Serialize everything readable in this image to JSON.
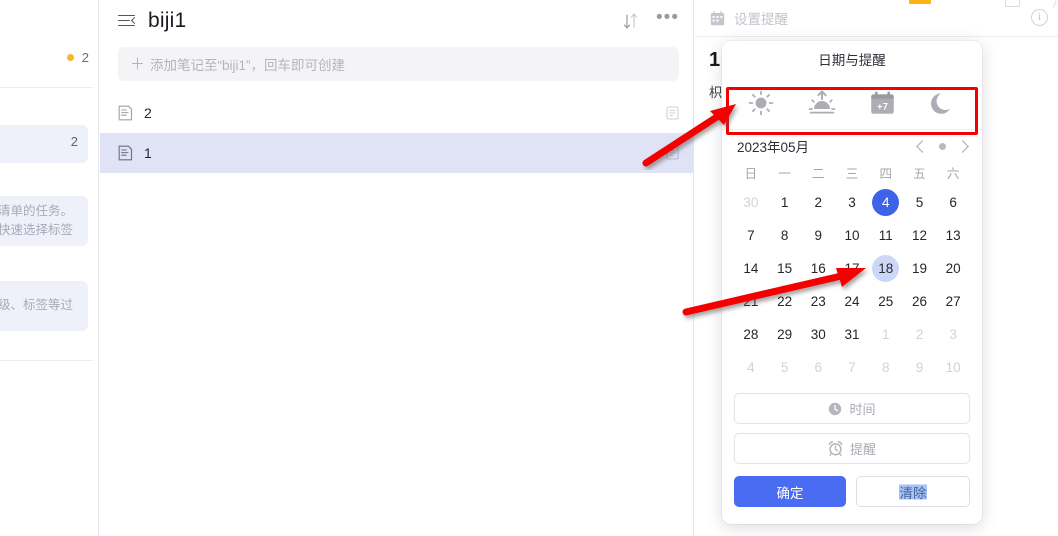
{
  "sidebar_fragment": {
    "count_top": "2",
    "count_card": "2",
    "text_frag_1_line1": "清单的任务。",
    "text_frag_1_line2": "快速选择标签",
    "text_frag_2": "级、标签等过"
  },
  "note_list": {
    "title": "biji1",
    "menu_icon": "hamburger-collapse-icon",
    "sort_icon": "sort-icon",
    "more_icon": "more-options-icon",
    "add_placeholder": "添加笔记至“biji1”，回车即可创建",
    "add_plus": "＋",
    "items": [
      {
        "label": "2",
        "selected": false
      },
      {
        "label": "1",
        "selected": true
      }
    ]
  },
  "detail": {
    "toolbar_label": "设置提醒",
    "toolbar_icon": "calendar-icon",
    "info_icon": "info-icon",
    "title": "1",
    "subtitle": "枳"
  },
  "date_picker": {
    "title": "日期与提醒",
    "quick_actions": [
      {
        "name": "today-sun-icon",
        "label": "今天"
      },
      {
        "name": "tomorrow-sunrise-icon",
        "label": "明天"
      },
      {
        "name": "next-week-plus7-icon",
        "label": "+7"
      },
      {
        "name": "tonight-moon-icon",
        "label": "今晚"
      }
    ],
    "month_label": "2023年05月",
    "prev_icon": "chevron-left-icon",
    "today-dot_icon": "today-dot-icon",
    "next_icon": "chevron-right-icon",
    "weekdays": [
      "日",
      "一",
      "二",
      "三",
      "四",
      "五",
      "六"
    ],
    "weeks": [
      [
        {
          "d": "30",
          "state": "muted"
        },
        {
          "d": "1",
          "state": ""
        },
        {
          "d": "2",
          "state": ""
        },
        {
          "d": "3",
          "state": ""
        },
        {
          "d": "4",
          "state": "selected"
        },
        {
          "d": "5",
          "state": ""
        },
        {
          "d": "6",
          "state": ""
        }
      ],
      [
        {
          "d": "7",
          "state": ""
        },
        {
          "d": "8",
          "state": ""
        },
        {
          "d": "9",
          "state": ""
        },
        {
          "d": "10",
          "state": ""
        },
        {
          "d": "11",
          "state": ""
        },
        {
          "d": "12",
          "state": ""
        },
        {
          "d": "13",
          "state": ""
        }
      ],
      [
        {
          "d": "14",
          "state": ""
        },
        {
          "d": "15",
          "state": ""
        },
        {
          "d": "16",
          "state": ""
        },
        {
          "d": "17",
          "state": ""
        },
        {
          "d": "18",
          "state": "hover"
        },
        {
          "d": "19",
          "state": ""
        },
        {
          "d": "20",
          "state": ""
        }
      ],
      [
        {
          "d": "21",
          "state": ""
        },
        {
          "d": "22",
          "state": ""
        },
        {
          "d": "23",
          "state": ""
        },
        {
          "d": "24",
          "state": ""
        },
        {
          "d": "25",
          "state": ""
        },
        {
          "d": "26",
          "state": ""
        },
        {
          "d": "27",
          "state": ""
        }
      ],
      [
        {
          "d": "28",
          "state": ""
        },
        {
          "d": "29",
          "state": ""
        },
        {
          "d": "30",
          "state": ""
        },
        {
          "d": "31",
          "state": ""
        },
        {
          "d": "1",
          "state": "muted"
        },
        {
          "d": "2",
          "state": "muted"
        },
        {
          "d": "3",
          "state": "muted"
        }
      ],
      [
        {
          "d": "4",
          "state": "muted"
        },
        {
          "d": "5",
          "state": "muted"
        },
        {
          "d": "6",
          "state": "muted"
        },
        {
          "d": "7",
          "state": "muted"
        },
        {
          "d": "8",
          "state": "muted"
        },
        {
          "d": "9",
          "state": "muted"
        },
        {
          "d": "10",
          "state": "muted"
        }
      ]
    ],
    "time_field": {
      "label": "时间",
      "icon": "clock-icon"
    },
    "reminder_field": {
      "label": "提醒",
      "icon": "alarm-clock-icon"
    },
    "confirm_label": "确定",
    "clear_label": "清除"
  },
  "colors": {
    "accent_blue": "#4a6cf2",
    "selected_day": "#3d63e8",
    "hover_day": "#ccd6f7",
    "annotation_red": "#f50000",
    "row_selected": "#dfe3f5",
    "orange_chip": "#fcb215"
  }
}
